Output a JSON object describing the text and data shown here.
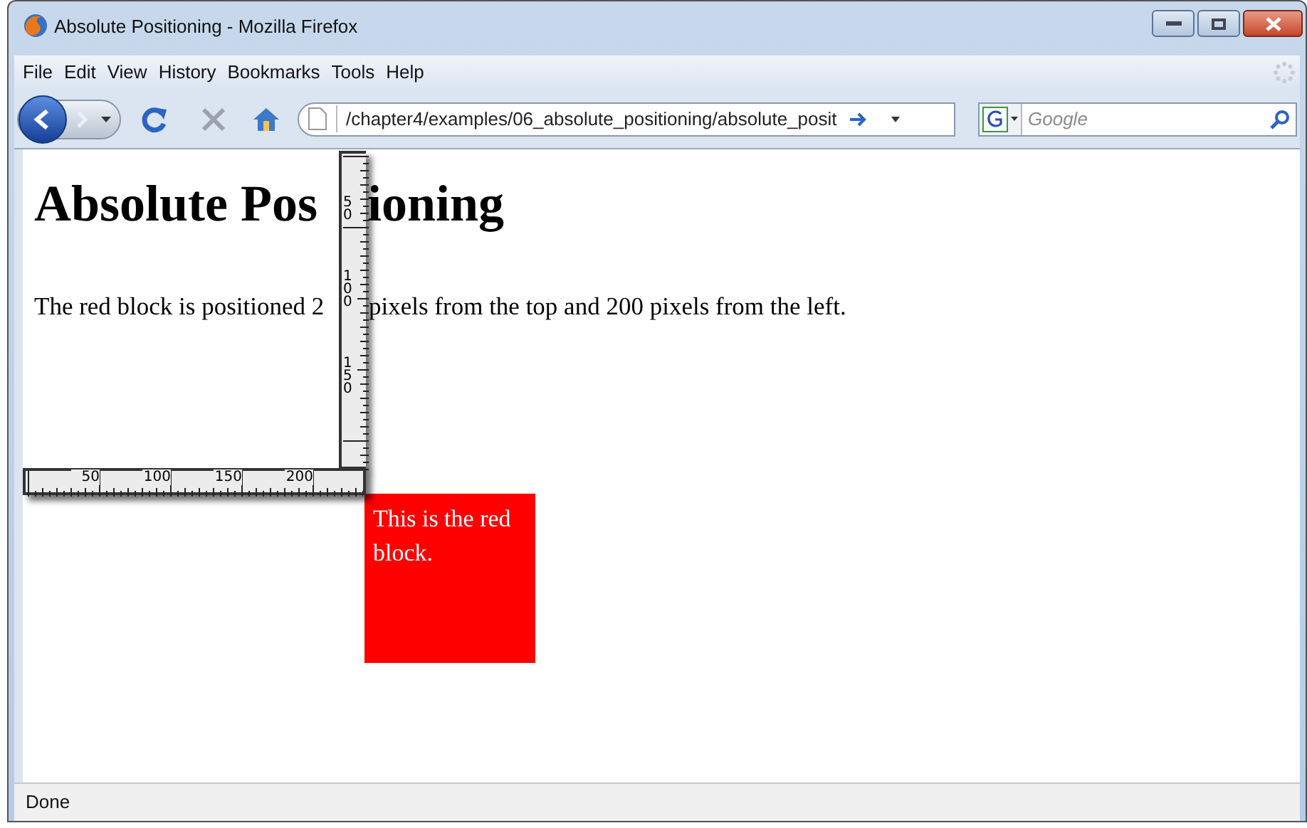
{
  "window": {
    "title": "Absolute Positioning - Mozilla Firefox"
  },
  "menu": [
    {
      "label": "File"
    },
    {
      "label": "Edit"
    },
    {
      "label": "View"
    },
    {
      "label": "History"
    },
    {
      "label": "Bookmarks"
    },
    {
      "label": "Tools"
    },
    {
      "label": "Help"
    }
  ],
  "toolbar": {
    "address": "/chapter4/examples/06_absolute_positioning/absolute_posit",
    "search": {
      "placeholder": "Google"
    }
  },
  "page": {
    "heading_parts": [
      "Absolute Pos",
      "ioning"
    ],
    "paragraph_parts": [
      "The red block is positioned 2",
      "pixels from the top and 200 pixels from the left."
    ],
    "red_block": "This is the red block."
  },
  "ruler": {
    "horizontal_labels": [
      "50",
      "100",
      "150",
      "200"
    ],
    "vertical_labels": [
      "50",
      "100",
      "150"
    ]
  },
  "status_bar": {
    "text": "Done"
  }
}
